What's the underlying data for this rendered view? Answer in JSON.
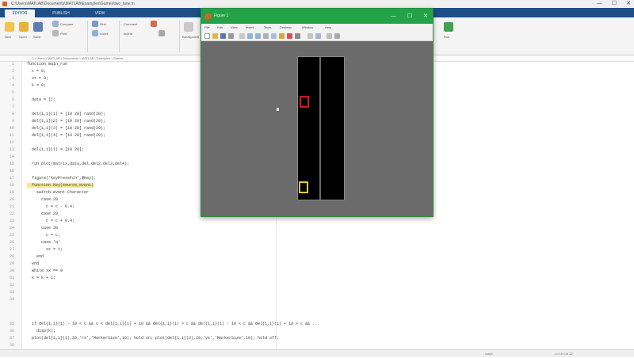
{
  "app": {
    "title_path": "C:\\Users\\MATLAB\\Documents\\MATLAB\\Examples\\Games\\two_lane.m",
    "controls": [
      "—",
      "☐",
      "✕"
    ]
  },
  "ribbon": {
    "tabs": [
      "EDITOR",
      "PUBLISH",
      "VIEW"
    ],
    "buttons": [
      "New",
      "Open",
      "Save",
      "Compare",
      "Print",
      "Find",
      "Insert",
      "Comment",
      "Indent",
      "Breakpoints",
      "Run"
    ]
  },
  "address": {
    "path": "C:\\ Users \\ MATLAB \\ Documents \\ MATLAB \\ Examples \\ Games"
  },
  "editor": {
    "line_numbers": [
      "1",
      "2",
      "3",
      "4",
      "5",
      "6",
      "7",
      "8",
      "9",
      "10",
      "11",
      "12",
      "13",
      "14",
      "15",
      "16",
      "17",
      "18",
      "19",
      "20",
      "21",
      "22",
      "23",
      "24",
      "25",
      "26",
      "27",
      "28",
      "29",
      "30",
      "31",
      "32",
      "33",
      "34",
      "35",
      "36",
      "37",
      "38"
    ],
    "lines": [
      "function main_run",
      "  c = 0;",
      "  xx = 0;",
      "  k = 0;",
      "",
      "  data = [];",
      "",
      "  del{1,1}(1) = [10 20] rand(20);",
      "  del{1,1}(2) = [10 20] rand(20);",
      "  del{1,1}(3) = [10 20] rand(20);",
      "  del{1,1}(4) = [10 20] rand(20);",
      "",
      "  del{1,1}(1) = [10 20];",
      "",
      "  run plot(matrix,data,del,del2,del3,del4);",
      "",
      "  figure('KeyPressFcn',@Key);",
      "  function Key(source,event)",
      "    switch event.Character",
      "      case 28",
      "        c = c - 0.4;",
      "      case 29",
      "        c = c + 0.4;",
      "      case 30",
      "        c = c;",
      "      case 'q'",
      "        xx = 1;",
      "    end",
      "  end",
      "  while xx == 0",
      "  k = k + 1;",
      "",
      "",
      "",
      "  if del{1,1}(1) - 10 < c && c < del{1,1}(1) + 10 && del{1,1}(1) > c && del{1,1}(1) - 10 < c && del{1,1}(1) + 10 > c && ...",
      "    disp(k);",
      "  plot(del{1,1}(1),20,'rs','MarkerSize',10); hold on; plot(del{1,1}(2),20,'ys','MarkerSize',10); hold off;",
      ""
    ]
  },
  "status": {
    "left": "script",
    "right": "Ln 18   Col 22"
  },
  "figure": {
    "title": "Figure 1",
    "menu": [
      "File",
      "Edit",
      "View",
      "Insert",
      "Tools",
      "Desktop",
      "Window",
      "Help"
    ],
    "controls": [
      "—",
      "☐",
      "✕"
    ],
    "canvas_color": "#6b6b6b",
    "arena_color": "#000000",
    "player_colors": {
      "red": "#d11a1a",
      "yellow": "#e1d021"
    }
  }
}
